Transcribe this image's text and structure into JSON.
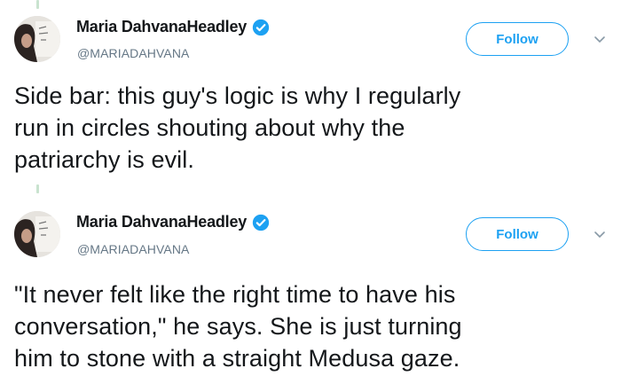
{
  "tweets": [
    {
      "author": {
        "display_name": "Maria DahvanaHeadley",
        "handle": "@MARIADAHVANA",
        "verified": true
      },
      "follow_label": "Follow",
      "text_lines": [
        "Side bar: this guy's logic is why I regularly",
        "run in circles shouting about why the",
        "patriarchy is evil."
      ]
    },
    {
      "author": {
        "display_name": "Maria DahvanaHeadley",
        "handle": "@MARIADAHVANA",
        "verified": true
      },
      "follow_label": "Follow",
      "text_lines": [
        "\"It never felt like the right time to have his",
        "conversation,\" he says. She is just turning",
        "him to stone with a straight Medusa gaze."
      ]
    }
  ],
  "colors": {
    "accent": "#1da1f2",
    "text": "#14171a",
    "muted": "#657786"
  }
}
